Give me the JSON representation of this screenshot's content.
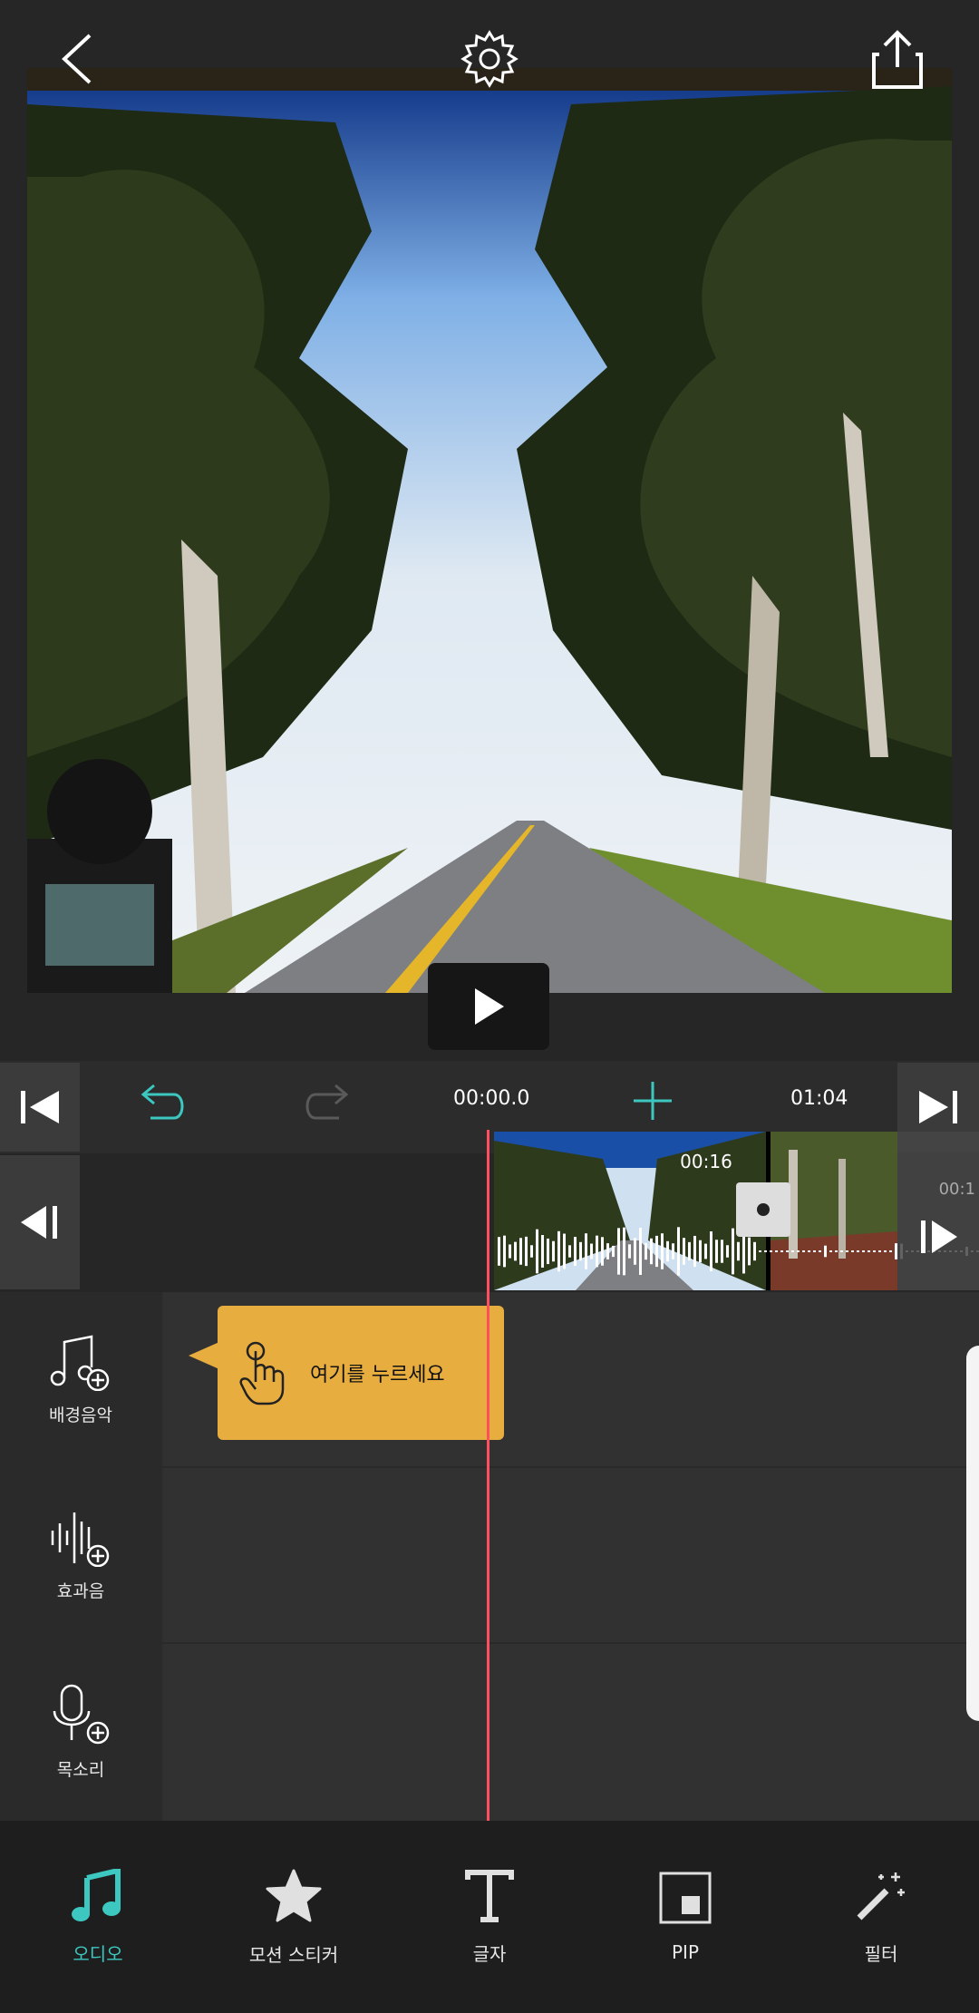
{
  "colors": {
    "accent": "#3cc7c0",
    "playhead": "#ff4f5e",
    "tooltip": "#e8ad3f"
  },
  "header": {
    "back_icon": "chevron-left-icon",
    "settings_icon": "gear-icon",
    "share_icon": "share-icon"
  },
  "player": {
    "play_icon": "play-icon"
  },
  "timeline": {
    "current_time": "00:00.0",
    "total_time": "01:04",
    "clip_duration": "00:16",
    "next_clip_duration": "00:1"
  },
  "tooltip": {
    "text": "여기를 누르세요"
  },
  "tracks": [
    {
      "label": "배경음악",
      "icon": "music-add-icon"
    },
    {
      "label": "효과음",
      "icon": "sound-effect-add-icon"
    },
    {
      "label": "목소리",
      "icon": "microphone-add-icon"
    }
  ],
  "bottom_nav": [
    {
      "label": "오디오",
      "icon": "music-note-icon",
      "active": true
    },
    {
      "label": "모션 스티커",
      "icon": "star-icon",
      "active": false
    },
    {
      "label": "글자",
      "icon": "text-icon",
      "active": false
    },
    {
      "label": "PIP",
      "icon": "pip-icon",
      "active": false
    },
    {
      "label": "필터",
      "icon": "magic-wand-icon",
      "active": false
    }
  ]
}
